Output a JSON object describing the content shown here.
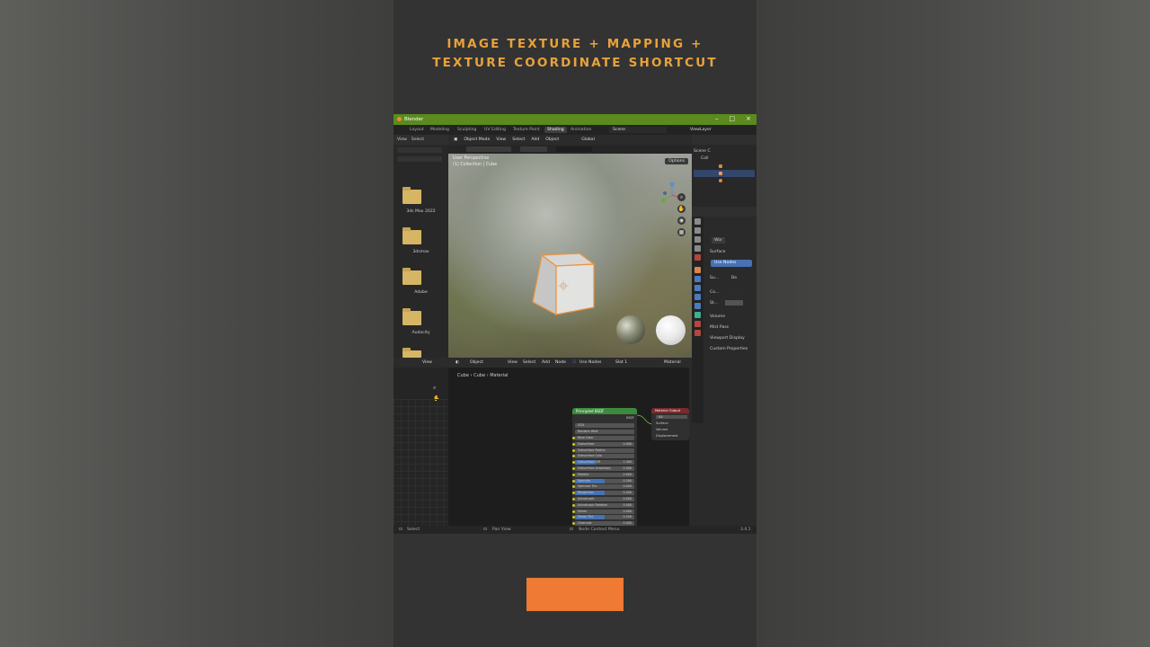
{
  "caption": {
    "line1": "IMAGE TEXTURE + MAPPING +",
    "line2": "TEXTURE COORDINATE SHORTCUT"
  },
  "window": {
    "title": "Blender",
    "minimize_icon": "minimize-icon",
    "maximize_icon": "maximize-icon",
    "close_icon": "close-icon"
  },
  "workspace_tabs": [
    "Layout",
    "Modeling",
    "Sculpting",
    "UV Editing",
    "Texture Paint",
    "Shading",
    "Animation"
  ],
  "active_tab": "Shading",
  "scene_name": "Scene",
  "view_layer": "ViewLayer",
  "file_browser": {
    "menu": [
      "View",
      "Select"
    ],
    "folders": [
      "3ds Max 2022",
      "3dsmax",
      "Adobe",
      "Audacity"
    ]
  },
  "viewport": {
    "mode": "Object Mode",
    "menu": [
      "View",
      "Select",
      "Add",
      "Object"
    ],
    "transform": "Global",
    "overlay_line1": "User Perspective",
    "overlay_line2": "(1) Collection | Cube",
    "options_label": "Options"
  },
  "outliner": {
    "rows": [
      "Scene C",
      "Coll",
      "",
      "",
      ""
    ]
  },
  "properties": {
    "material_name": "Wor",
    "surface_label": "Surface",
    "use_nodes_label": "Use Nodes",
    "surface_field_label": "Su...",
    "surface_value": "Ba",
    "color_label": "Co...",
    "strength_label": "St...",
    "sections": [
      "Volume",
      "Mist Pass",
      "Viewport Display",
      "Custom Properties"
    ]
  },
  "node_editor": {
    "object_dropdown": "Object",
    "menu": [
      "View",
      "Select",
      "Add",
      "Node"
    ],
    "use_nodes_label": "Use Nodes",
    "slot": "Slot 1",
    "material": "Material",
    "breadcrumb": [
      "Cube",
      "Cube",
      "Material"
    ],
    "bsdf": {
      "title": "Principled BSDF",
      "output_label": "BSDF",
      "distribution": "GGX",
      "subsurface_method": "Random Walk",
      "rows": [
        {
          "label": "Base Color",
          "value": "",
          "fill": 0
        },
        {
          "label": "Subsurface",
          "value": "0.000",
          "fill": 0
        },
        {
          "label": "Subsurface Radius",
          "value": "",
          "fill": 0
        },
        {
          "label": "Subsurface Colo",
          "value": "",
          "fill": 0
        },
        {
          "label": "Subsurface IOR",
          "value": "1.400",
          "fill": 0.35
        },
        {
          "label": "Subsurface Anisotropy",
          "value": "0.000",
          "fill": 0
        },
        {
          "label": "Metallic",
          "value": "0.000",
          "fill": 0
        },
        {
          "label": "Specular",
          "value": "0.500",
          "fill": 0.5
        },
        {
          "label": "Specular Tint",
          "value": "0.000",
          "fill": 0
        },
        {
          "label": "Roughness",
          "value": "0.500",
          "fill": 0.5
        },
        {
          "label": "Anisotropic",
          "value": "0.000",
          "fill": 0
        },
        {
          "label": "Anisotropic Rotation",
          "value": "0.000",
          "fill": 0
        },
        {
          "label": "Sheen",
          "value": "0.000",
          "fill": 0
        },
        {
          "label": "Sheen Tint",
          "value": "0.500",
          "fill": 0.5
        },
        {
          "label": "Clearcoat",
          "value": "0.000",
          "fill": 0
        }
      ]
    },
    "material_output": {
      "title": "Material Output",
      "target": "All",
      "inputs": [
        "Surface",
        "Volume",
        "Displacement"
      ]
    }
  },
  "statusbar": {
    "left": "Select",
    "middle": "Pan View",
    "right": "Node Context Menu",
    "version": "3.4.1"
  },
  "colors": {
    "caption": "#e8a23a",
    "titlebar": "#5b8a1e",
    "accent_blue": "#4772b3",
    "cube_outline": "#f0923a",
    "orange_box": "#ee7a33"
  }
}
